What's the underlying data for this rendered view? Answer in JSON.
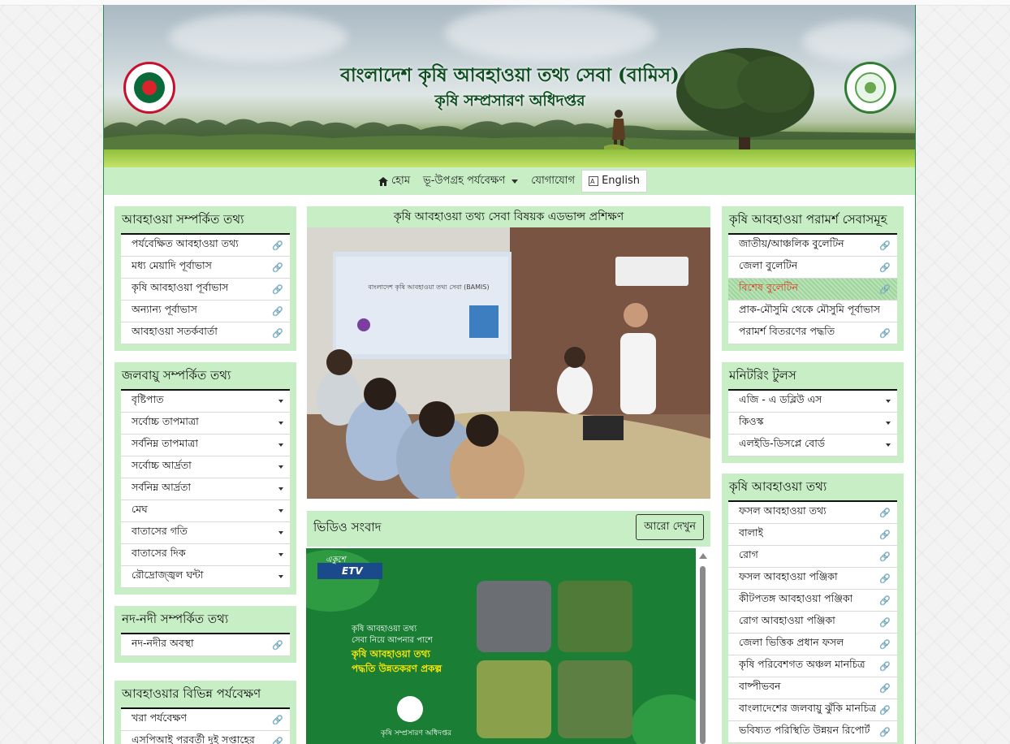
{
  "banner": {
    "title": "বাংলাদেশ কৃষি আবহাওয়া তথ্য সেবা (বামিস)",
    "subtitle": "কৃষি সম্প্রসারণ অধিদপ্তর"
  },
  "nav": {
    "home": "হোম",
    "satellite": "ভূ-উপগ্রহ পর্যবেক্ষণ",
    "contact": "যোগাযোগ",
    "language": "English"
  },
  "left_panels": [
    {
      "title": "আবহাওয়া সম্পর্কিত তথ্য",
      "items": [
        "পর্যবেক্ষিত আবহাওয়া তথ্য",
        "মধ্য মেয়াদি পূর্বাভাস",
        "কৃষি আবহাওয়া পূর্বাভাস",
        "অন্যান্য পূর্বাভাস",
        "আবহাওয়া সতর্কবার্তা"
      ]
    },
    {
      "title": "জলবায়ু সম্পর্কিত তথ্য",
      "items": [
        "বৃষ্টিপাত",
        "সর্বোচ্চ তাপমাত্রা",
        "সর্বনিম্ন তাপমাত্রা",
        "সর্বোচ্চ আর্দ্রতা",
        "সর্বনিম্ন আর্দ্রতা",
        "মেঘ",
        "বাতাসের গতি",
        "বাতাসের দিক",
        "রৌদ্রোজ্জ্বল ঘন্টা"
      ]
    },
    {
      "title": "নদ-নদী সম্পর্কিত তথ্য",
      "items": [
        "নদ-নদীর অবস্থা"
      ]
    },
    {
      "title": "আবহাওয়ার বিভিন্ন পর্যবেক্ষণ",
      "items": [
        "খরা পর্যবেক্ষণ",
        "এসপিআই পরবর্তী দুই সপ্তাহের"
      ]
    }
  ],
  "center": {
    "training_title": "কৃষি আবহাওয়া তথ্য সেবা বিষয়ক এডভান্স প্রশিক্ষণ",
    "slide_title": "বাংলাদেশ কৃষি আবহাওয়া তথ্য সেবা (BAMIS)",
    "video_title": "ভিডিও সংবাদ",
    "more_button": "আরো দেখুন",
    "video": {
      "channel": "ETV",
      "channel_top": "একুশে",
      "line1": "কৃষি আবহাওয়া তথ্য",
      "line2": "সেবা নিয়ে আপনার পাশে",
      "headline1": "কৃষি আবহাওয়া তথ্য",
      "headline2": "পদ্ধতি উন্নতকরণ প্রকল্প",
      "org": "কৃষি সম্প্রসারণ অধিদপ্তর"
    }
  },
  "right_panels": [
    {
      "title": "কৃষি আবহাওয়া পরামর্শ সেবাসমূহ",
      "items": [
        "জাতীয়/আঞ্চলিক বুলেটিন",
        "জেলা বুলেটিন",
        "বিশেষ বুলেটিন",
        "প্রাক-মৌসুমি থেকে মৌসুমি পূর্বাভাস",
        "পরামর্শ বিতরণের পদ্ধতি"
      ],
      "active_index": 2
    },
    {
      "title": "মনিটরিং টুলস",
      "items": [
        "এজি - এ ডব্লিউ এস",
        "কিওস্ক",
        "এলইডি-ডিসপ্লে বোর্ড"
      ]
    },
    {
      "title": "কৃষি আবহাওয়া তথ্য",
      "items": [
        "ফসল আবহাওয়া তথ্য",
        "বালাই",
        "রোগ",
        "ফসল আবহাওয়া পঞ্জিকা",
        "কীটপতঙ্গ আবহাওয়া পঞ্জিকা",
        "রোগ আবহাওয়া পঞ্জিকা",
        "জেলা ভিত্তিক প্রধান ফসল",
        "কৃষি পরিবেশগত অঞ্চল মানচিত্র",
        "বাষ্পীভবন",
        "বাংলাদেশের জলবায়ু ঝুঁকি মানচিত্র",
        "ভবিষ্যত পরিস্থিতি উন্নয়ন রিপোর্ট"
      ]
    }
  ],
  "icons": {
    "link": "link-icon",
    "dropdown": "chevron-down-icon",
    "home": "home-icon",
    "translate": "translate-icon"
  },
  "colors": {
    "panel_bg": "#c8eec6",
    "title_green": "#0d4d1f",
    "active_text": "#d93a2b",
    "link_icon": "#2e9b4a",
    "border_green": "#2e8b57"
  }
}
